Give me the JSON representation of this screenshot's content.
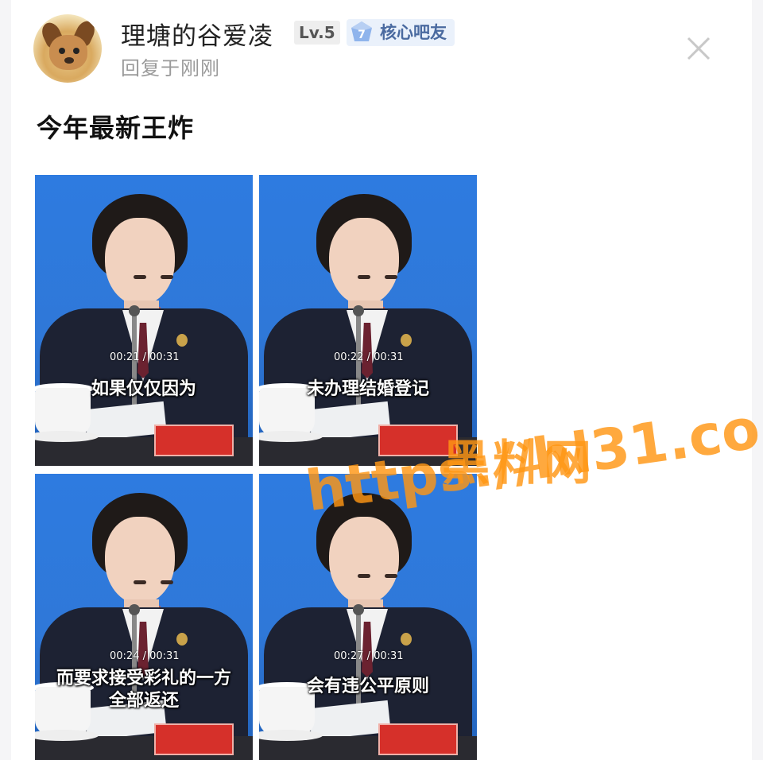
{
  "post": {
    "username": "理塘的谷爱凌",
    "level": "Lv.5",
    "badge_number": "7",
    "badge_label": "核心吧友",
    "reply_time": "回复于刚刚",
    "text": "今年最新王炸"
  },
  "frames": [
    {
      "timecode": "00:21 / 00:31",
      "caption": "如果仅仅因为"
    },
    {
      "timecode": "00:22 / 00:31",
      "caption": "未办理结婚登记"
    },
    {
      "timecode": "00:24 / 00:31",
      "caption_line1": "而要求接受彩礼的一方",
      "caption_line2": "全部返还"
    },
    {
      "timecode": "00:27 / 00:31",
      "caption": "会有违公平原则"
    }
  ],
  "watermark": {
    "title": "黑料网",
    "url": "https://hl31.co"
  },
  "colors": {
    "accent_badge": "#4a6aa0",
    "watermark": "#ff9614",
    "background_blue": "#2e7be0"
  },
  "icons": {
    "close": "close-icon",
    "badge": "gem-icon"
  }
}
